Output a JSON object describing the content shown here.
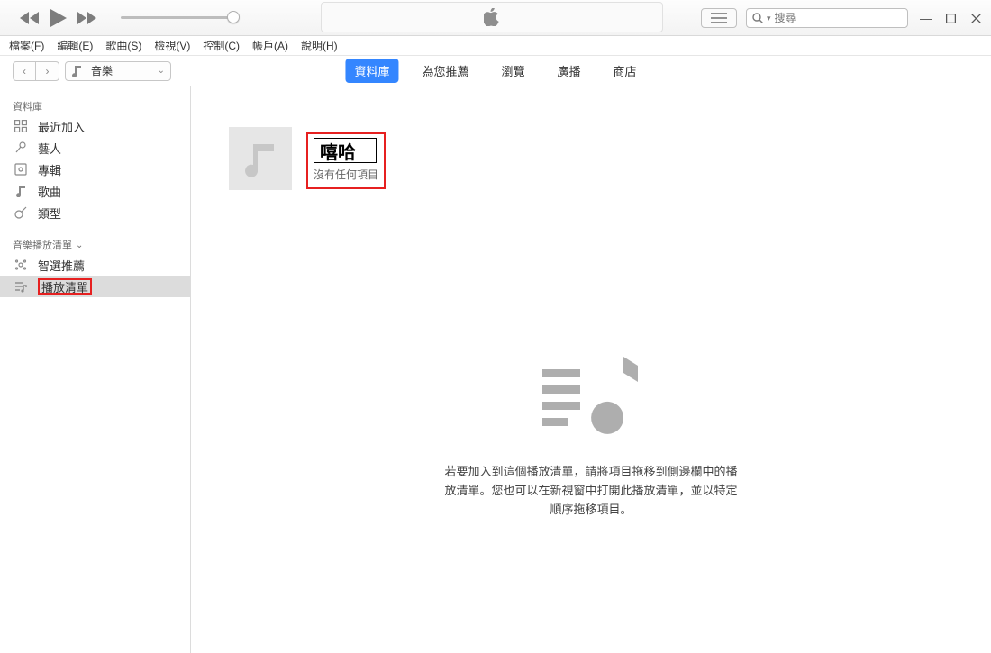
{
  "search": {
    "placeholder": "搜尋"
  },
  "menu": {
    "file": "檔案(F)",
    "edit": "編輯(E)",
    "song": "歌曲(S)",
    "view": "檢視(V)",
    "control": "控制(C)",
    "account": "帳戶(A)",
    "help": "說明(H)"
  },
  "source_selector": {
    "label": "音樂"
  },
  "tabs": {
    "library": "資料庫",
    "for_you": "為您推薦",
    "browse": "瀏覽",
    "radio": "廣播",
    "store": "商店"
  },
  "sidebar": {
    "library_header": "資料庫",
    "items": {
      "recent": "最近加入",
      "artists": "藝人",
      "albums": "專輯",
      "songs": "歌曲",
      "genres": "類型"
    },
    "playlists_header": "音樂播放清單",
    "smart": "智選推薦",
    "playlist_editing": "播放清單"
  },
  "playlist": {
    "title": "嘻哈",
    "empty_subtitle": "沒有任何項目"
  },
  "empty": {
    "line1": "若要加入到這個播放清單，請將項目拖移到側邊欄中的播",
    "line2": "放清單。您也可以在新視窗中打開此播放清單，並以特定",
    "line3": "順序拖移項目。"
  }
}
